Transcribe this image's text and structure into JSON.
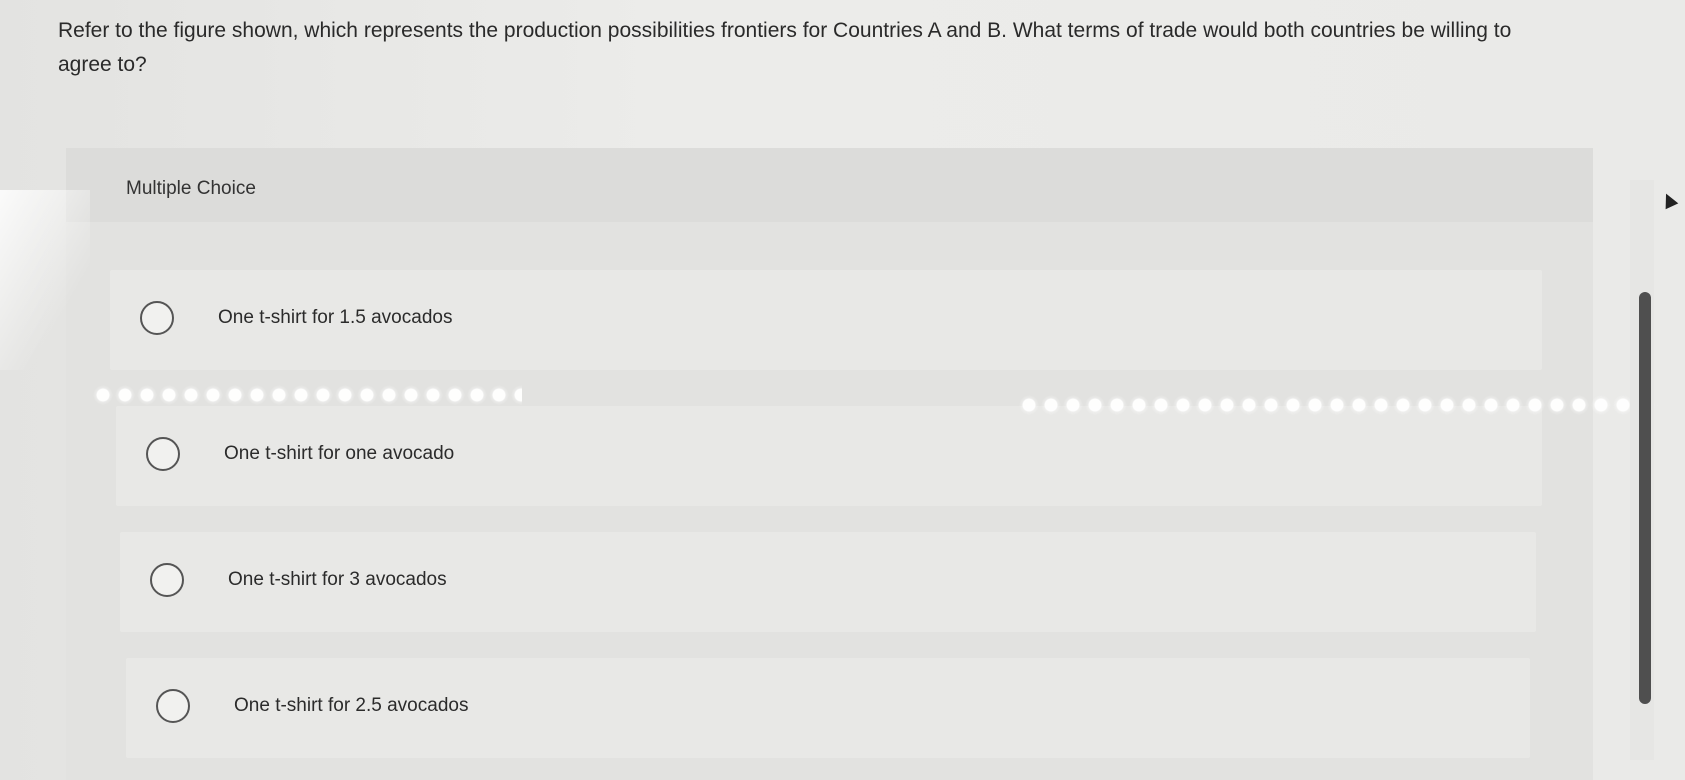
{
  "question": {
    "text": "Refer to the figure shown, which represents the production possibilities frontiers for Countries A and B. What terms of trade would both countries be willing to agree to?"
  },
  "multiple_choice": {
    "header": "Multiple Choice",
    "options": [
      {
        "label": "One t-shirt for 1.5 avocados"
      },
      {
        "label": "One t-shirt for one avocado"
      },
      {
        "label": "One t-shirt for 3 avocados"
      },
      {
        "label": "One t-shirt for 2.5 avocados"
      }
    ]
  },
  "icons": {
    "radio": "radio-unselected-icon",
    "cursor": "mouse-pointer-icon"
  },
  "colors": {
    "background": "#e9e9e7",
    "panel": "#e2e2e0",
    "header": "#dcdcda",
    "option": "#e8e8e6",
    "scrollbar_thumb": "#4f4f4f"
  }
}
